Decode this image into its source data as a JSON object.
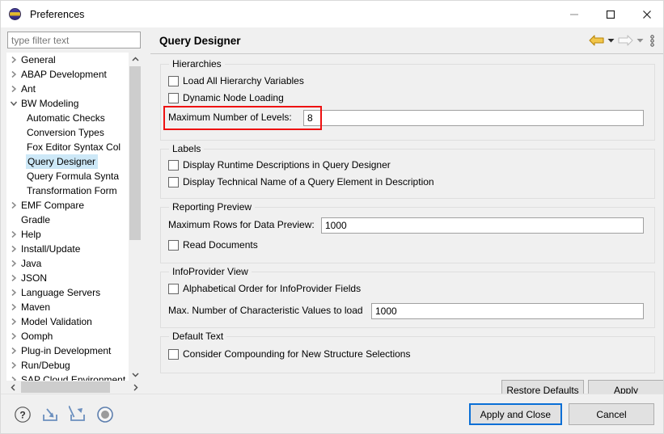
{
  "window": {
    "title": "Preferences",
    "icon": "eclipse-sphere-icon",
    "minimize_label": "minimize-icon",
    "maximize_label": "maximize-icon",
    "close_label": "close-icon"
  },
  "filter": {
    "placeholder": "type filter text",
    "value": ""
  },
  "tree": {
    "items": [
      {
        "label": "General",
        "level": 0,
        "expandable": true,
        "expanded": false,
        "selected": false
      },
      {
        "label": "ABAP Development",
        "level": 0,
        "expandable": true,
        "expanded": false,
        "selected": false
      },
      {
        "label": "Ant",
        "level": 0,
        "expandable": true,
        "expanded": false,
        "selected": false
      },
      {
        "label": "BW Modeling",
        "level": 0,
        "expandable": true,
        "expanded": true,
        "selected": false
      },
      {
        "label": "Automatic Checks",
        "level": 1,
        "expandable": false,
        "expanded": false,
        "selected": false
      },
      {
        "label": "Conversion Types",
        "level": 1,
        "expandable": false,
        "expanded": false,
        "selected": false
      },
      {
        "label": "Fox Editor Syntax Col",
        "level": 1,
        "expandable": false,
        "expanded": false,
        "selected": false
      },
      {
        "label": "Query Designer",
        "level": 1,
        "expandable": false,
        "expanded": false,
        "selected": true
      },
      {
        "label": "Query Formula Synta",
        "level": 1,
        "expandable": false,
        "expanded": false,
        "selected": false
      },
      {
        "label": "Transformation Form",
        "level": 1,
        "expandable": false,
        "expanded": false,
        "selected": false
      },
      {
        "label": "EMF Compare",
        "level": 0,
        "expandable": true,
        "expanded": false,
        "selected": false
      },
      {
        "label": "Gradle",
        "level": 0,
        "expandable": false,
        "expanded": false,
        "selected": false
      },
      {
        "label": "Help",
        "level": 0,
        "expandable": true,
        "expanded": false,
        "selected": false
      },
      {
        "label": "Install/Update",
        "level": 0,
        "expandable": true,
        "expanded": false,
        "selected": false
      },
      {
        "label": "Java",
        "level": 0,
        "expandable": true,
        "expanded": false,
        "selected": false
      },
      {
        "label": "JSON",
        "level": 0,
        "expandable": true,
        "expanded": false,
        "selected": false
      },
      {
        "label": "Language Servers",
        "level": 0,
        "expandable": true,
        "expanded": false,
        "selected": false
      },
      {
        "label": "Maven",
        "level": 0,
        "expandable": true,
        "expanded": false,
        "selected": false
      },
      {
        "label": "Model Validation",
        "level": 0,
        "expandable": true,
        "expanded": false,
        "selected": false
      },
      {
        "label": "Oomph",
        "level": 0,
        "expandable": true,
        "expanded": false,
        "selected": false
      },
      {
        "label": "Plug-in Development",
        "level": 0,
        "expandable": true,
        "expanded": false,
        "selected": false
      },
      {
        "label": "Run/Debug",
        "level": 0,
        "expandable": true,
        "expanded": false,
        "selected": false
      },
      {
        "label": "SAP Cloud Environment",
        "level": 0,
        "expandable": true,
        "expanded": false,
        "selected": false
      }
    ]
  },
  "page": {
    "title": "Query Designer",
    "back_icon": "back-arrow-icon",
    "forward_icon": "forward-arrow-icon",
    "menu_icon": "view-menu-icon"
  },
  "groups": {
    "hierarchies": {
      "title": "Hierarchies",
      "load_all_hierarchy_variables": "Load All Hierarchy Variables",
      "dynamic_node_loading": "Dynamic Node Loading",
      "max_levels_label": "Maximum Number of Levels:",
      "max_levels_value": "8"
    },
    "labels": {
      "title": "Labels",
      "display_runtime_descriptions": "Display Runtime Descriptions in Query Designer",
      "display_technical_name": "Display Technical Name of a Query Element in Description"
    },
    "reporting_preview": {
      "title": "Reporting Preview",
      "max_rows_label": "Maximum Rows for Data Preview:",
      "max_rows_value": "1000",
      "read_documents": "Read Documents"
    },
    "infoprovider_view": {
      "title": "InfoProvider View",
      "alphabetical_order": "Alphabetical Order for InfoProvider Fields",
      "max_char_values_label": "Max. Number of Characteristic Values to load",
      "max_char_values_value": "1000"
    },
    "default_text": {
      "title": "Default Text",
      "consider_compounding": "Consider Compounding for New Structure Selections"
    }
  },
  "panel_buttons": {
    "restore_defaults": "Restore Defaults",
    "apply": "Apply"
  },
  "bottom_bar": {
    "help_icon": "help-icon",
    "import_icon": "import-preferences-icon",
    "export_icon": "export-preferences-icon",
    "oomph_icon": "oomph-recorder-icon",
    "apply_and_close": "Apply and Close",
    "cancel": "Cancel"
  },
  "colors": {
    "accent_focus": "#0a6fd6",
    "highlight_box": "#ee1111",
    "selection": "#cde8f7",
    "back_arrow": "#e0a920"
  }
}
